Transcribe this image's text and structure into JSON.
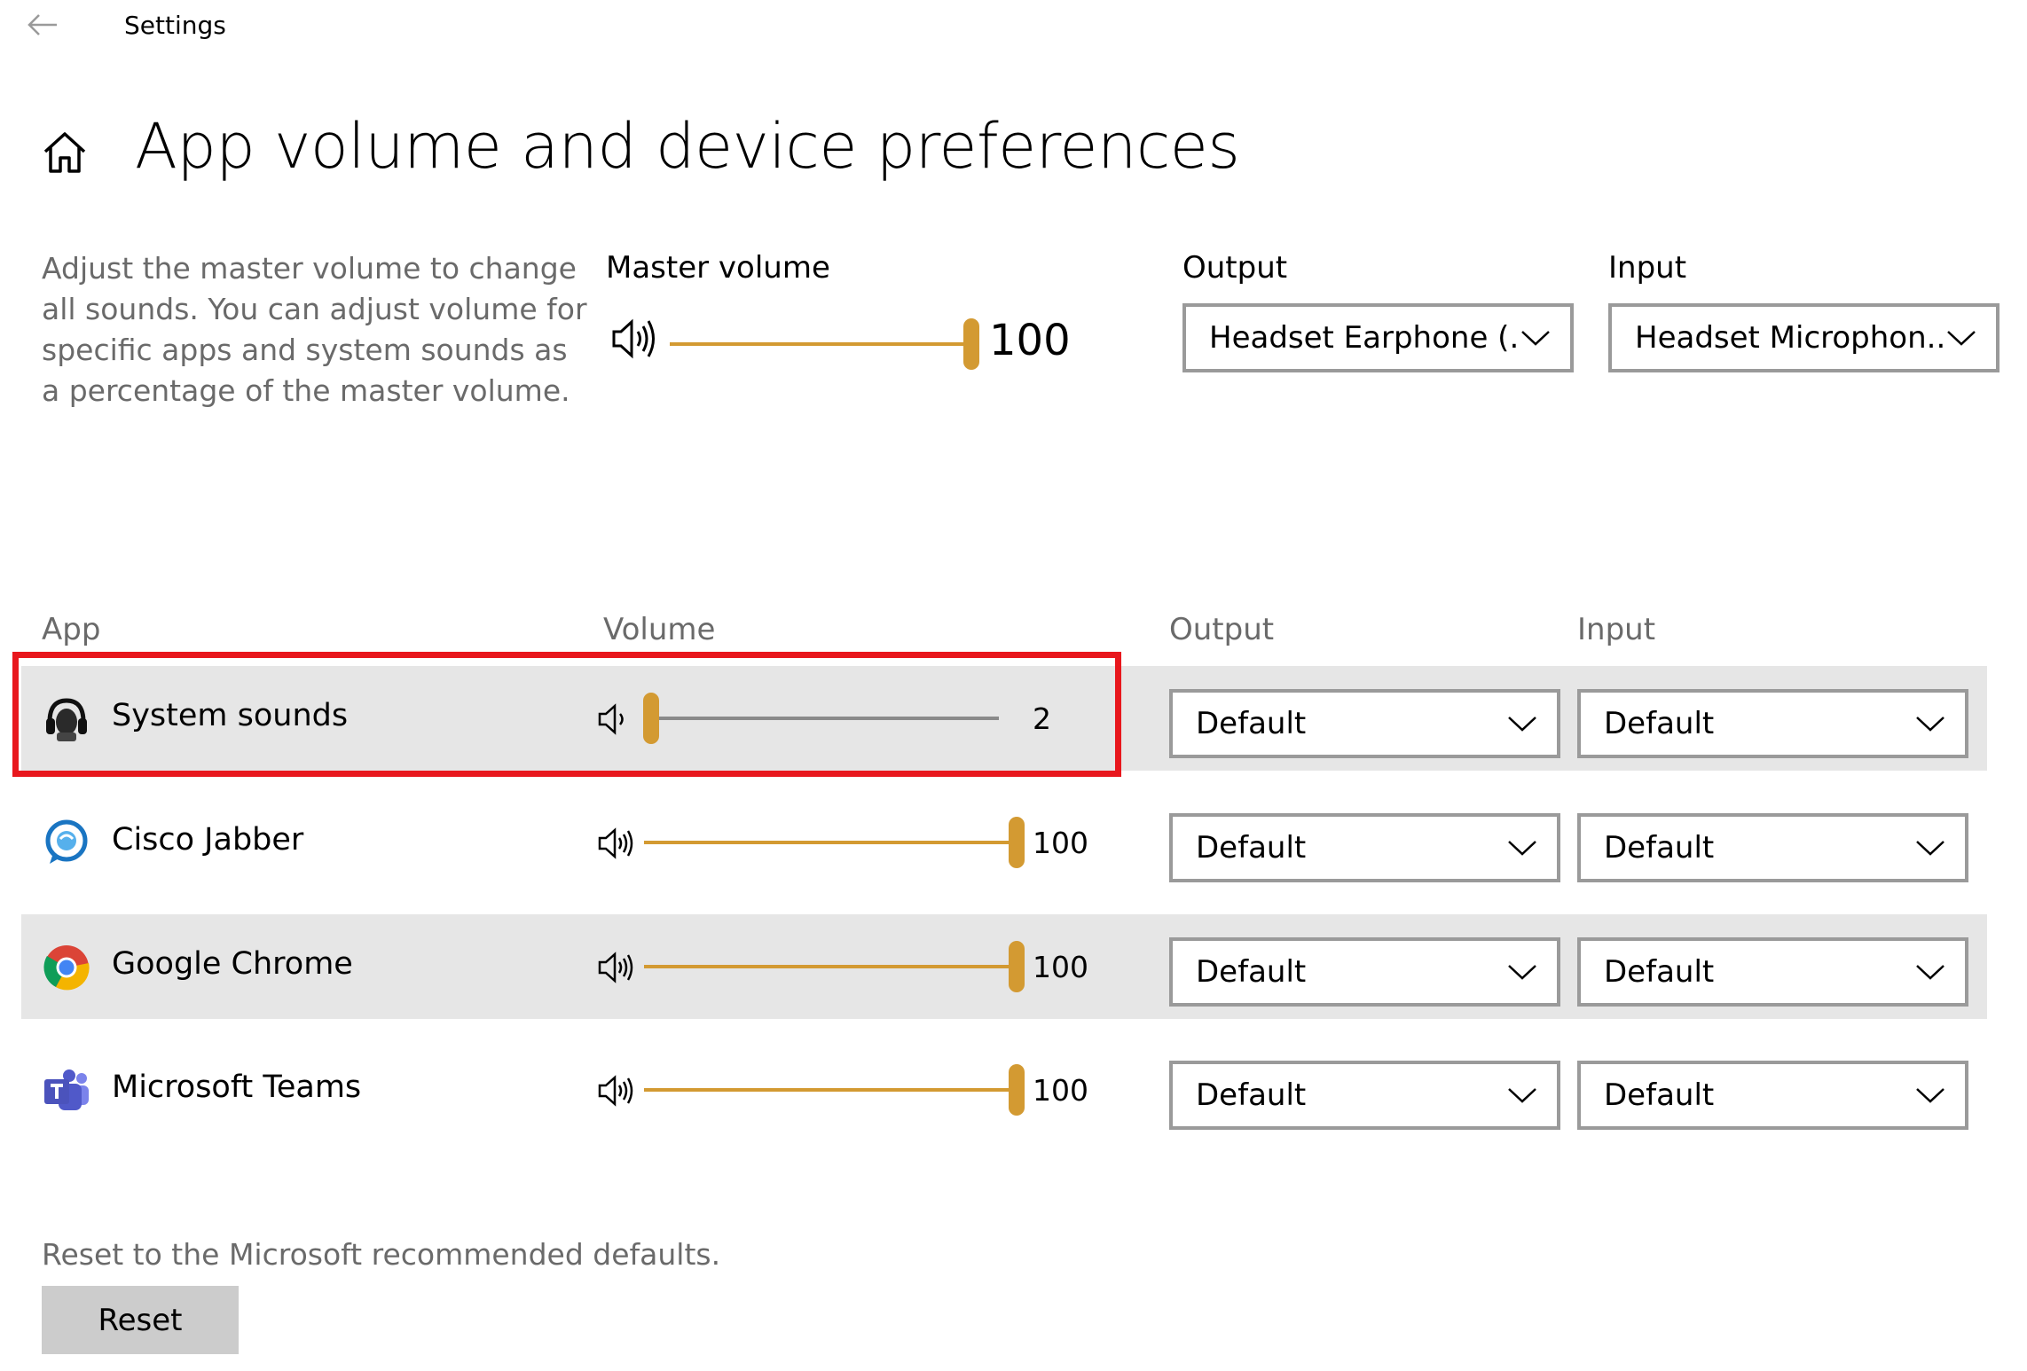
{
  "window": {
    "title": "Settings"
  },
  "header": {
    "title": "App volume and device preferences"
  },
  "description": "Adjust the master volume to change all sounds. You can adjust volume for specific apps and system sounds as a percentage of the master volume.",
  "master": {
    "label": "Master volume",
    "value": "100",
    "level": 100
  },
  "output": {
    "label": "Output",
    "selected": "Headset Earphone (..."
  },
  "input": {
    "label": "Input",
    "selected": "Headset Microphon..."
  },
  "table": {
    "headers": {
      "app": "App",
      "volume": "Volume",
      "output": "Output",
      "input": "Input"
    },
    "rows": [
      {
        "name": "System sounds",
        "volume": "2",
        "level": 2,
        "output": "Default",
        "input": "Default",
        "icon": "system-sounds-icon"
      },
      {
        "name": "Cisco Jabber",
        "volume": "100",
        "level": 100,
        "output": "Default",
        "input": "Default",
        "icon": "cisco-jabber-icon"
      },
      {
        "name": "Google Chrome",
        "volume": "100",
        "level": 100,
        "output": "Default",
        "input": "Default",
        "icon": "google-chrome-icon"
      },
      {
        "name": "Microsoft Teams",
        "volume": "100",
        "level": 100,
        "output": "Default",
        "input": "Default",
        "icon": "microsoft-teams-icon"
      }
    ]
  },
  "reset": {
    "text": "Reset to the Microsoft recommended defaults.",
    "button": "Reset"
  },
  "colors": {
    "accent": "#d39a32",
    "highlight": "#e8171d",
    "row_shade": "#e6e6e6"
  }
}
